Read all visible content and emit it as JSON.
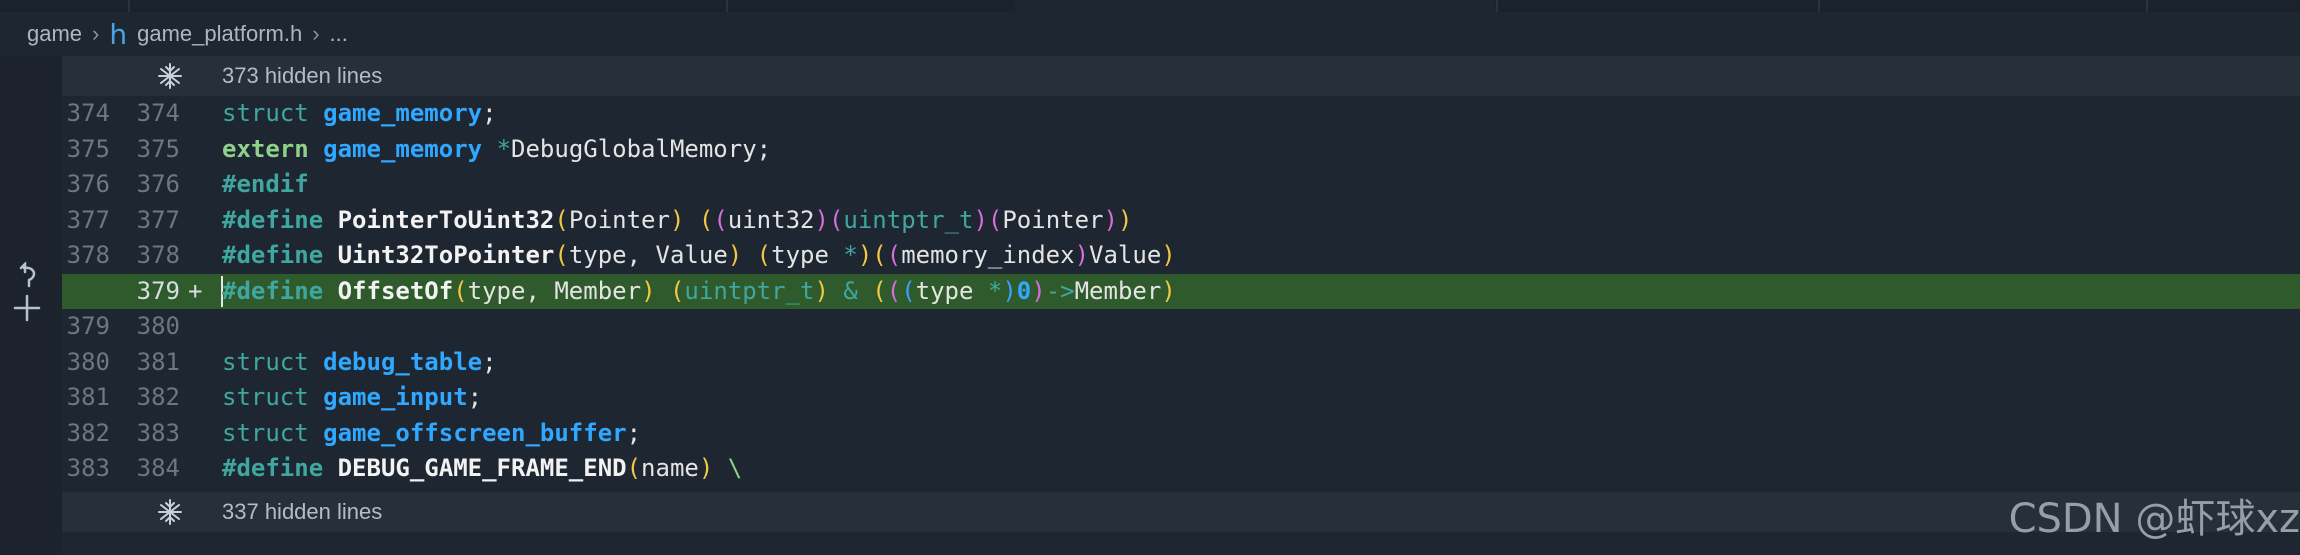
{
  "breadcrumb": {
    "root": "game",
    "file": "game_platform.h",
    "ellipsis": "..."
  },
  "hidden_top": {
    "label": "373 hidden lines"
  },
  "hidden_bottom": {
    "label": "337 hidden lines"
  },
  "lines": [
    {
      "left": "374",
      "right": "374",
      "added": false,
      "tokens": [
        [
          "kw",
          "struct"
        ],
        [
          "punc",
          " "
        ],
        [
          "type",
          "game_memory"
        ],
        [
          "punc",
          ";"
        ]
      ]
    },
    {
      "left": "375",
      "right": "375",
      "added": false,
      "tokens": [
        [
          "ext",
          "extern"
        ],
        [
          "punc",
          " "
        ],
        [
          "type",
          "game_memory"
        ],
        [
          "punc",
          " "
        ],
        [
          "op",
          "*"
        ],
        [
          "id",
          "DebugGlobalMemory"
        ],
        [
          "punc",
          ";"
        ]
      ]
    },
    {
      "left": "376",
      "right": "376",
      "added": false,
      "tokens": [
        [
          "pre",
          "#endif"
        ]
      ]
    },
    {
      "left": "377",
      "right": "377",
      "added": false,
      "tokens": [
        [
          "pre",
          "#define"
        ],
        [
          "punc",
          " "
        ],
        [
          "macro",
          "PointerToUint32"
        ],
        [
          "p1",
          "("
        ],
        [
          "id",
          "Pointer"
        ],
        [
          "p1",
          ")"
        ],
        [
          "punc",
          " "
        ],
        [
          "p1",
          "("
        ],
        [
          "p2",
          "("
        ],
        [
          "id",
          "uint32"
        ],
        [
          "p2",
          ")"
        ],
        [
          "p2",
          "("
        ],
        [
          "teal",
          "uintptr_t"
        ],
        [
          "p2",
          ")"
        ],
        [
          "p2",
          "("
        ],
        [
          "id",
          "Pointer"
        ],
        [
          "p2",
          ")"
        ],
        [
          "p1",
          ")"
        ]
      ]
    },
    {
      "left": "378",
      "right": "378",
      "added": false,
      "tokens": [
        [
          "pre",
          "#define"
        ],
        [
          "punc",
          " "
        ],
        [
          "macro",
          "Uint32ToPointer"
        ],
        [
          "p1",
          "("
        ],
        [
          "id",
          "type"
        ],
        [
          "punc",
          ", "
        ],
        [
          "id",
          "Value"
        ],
        [
          "p1",
          ")"
        ],
        [
          "punc",
          " "
        ],
        [
          "p1",
          "("
        ],
        [
          "id",
          "type"
        ],
        [
          "punc",
          " "
        ],
        [
          "op",
          "*"
        ],
        [
          "p1",
          ")"
        ],
        [
          "p1",
          "("
        ],
        [
          "p2",
          "("
        ],
        [
          "id",
          "memory_index"
        ],
        [
          "p2",
          ")"
        ],
        [
          "id",
          "Value"
        ],
        [
          "p1",
          ")"
        ]
      ]
    },
    {
      "left": "",
      "right": "379",
      "added": true,
      "plus": "+",
      "tokens": [
        [
          "pre",
          "#define"
        ],
        [
          "punc",
          " "
        ],
        [
          "macro",
          "OffsetOf"
        ],
        [
          "p1",
          "("
        ],
        [
          "id",
          "type"
        ],
        [
          "punc",
          ", "
        ],
        [
          "id",
          "Member"
        ],
        [
          "p1",
          ")"
        ],
        [
          "punc",
          " "
        ],
        [
          "p1",
          "("
        ],
        [
          "teal",
          "uintptr_t"
        ],
        [
          "p1",
          ")"
        ],
        [
          "punc",
          " "
        ],
        [
          "op",
          "&"
        ],
        [
          "punc",
          " "
        ],
        [
          "p1",
          "("
        ],
        [
          "p2",
          "("
        ],
        [
          "p3",
          "("
        ],
        [
          "id",
          "type"
        ],
        [
          "punc",
          " "
        ],
        [
          "op",
          "*"
        ],
        [
          "p3",
          ")"
        ],
        [
          "num",
          "0"
        ],
        [
          "p2",
          ")"
        ],
        [
          "op",
          "->"
        ],
        [
          "id",
          "Member"
        ],
        [
          "p1",
          ")"
        ]
      ]
    },
    {
      "left": "379",
      "right": "380",
      "added": false,
      "tokens": []
    },
    {
      "left": "380",
      "right": "381",
      "added": false,
      "tokens": [
        [
          "kw",
          "struct"
        ],
        [
          "punc",
          " "
        ],
        [
          "type",
          "debug_table"
        ],
        [
          "punc",
          ";"
        ]
      ]
    },
    {
      "left": "381",
      "right": "382",
      "added": false,
      "tokens": [
        [
          "kw",
          "struct"
        ],
        [
          "punc",
          " "
        ],
        [
          "type",
          "game_input"
        ],
        [
          "punc",
          ";"
        ]
      ]
    },
    {
      "left": "382",
      "right": "383",
      "added": false,
      "tokens": [
        [
          "kw",
          "struct"
        ],
        [
          "punc",
          " "
        ],
        [
          "type",
          "game_offscreen_buffer"
        ],
        [
          "punc",
          ";"
        ]
      ]
    },
    {
      "left": "383",
      "right": "384",
      "added": false,
      "tokens": [
        [
          "pre",
          "#define"
        ],
        [
          "punc",
          " "
        ],
        [
          "macro",
          "DEBUG_GAME_FRAME_END"
        ],
        [
          "p1",
          "("
        ],
        [
          "id",
          "name"
        ],
        [
          "p1",
          ")"
        ],
        [
          "punc",
          " "
        ],
        [
          "bs",
          "\\"
        ]
      ]
    }
  ],
  "icons": {
    "breadcrumb_separator": "chevron-right-icon",
    "file_type": "h-file-icon",
    "fold": "unfold-icon",
    "revert": "revert-arrow-icon",
    "add": "plus-icon"
  },
  "watermark": "CSDN @虾球xz",
  "colors": {
    "background": "#1e2631",
    "added_line": "#2f5a2c",
    "keyword": "#3fa7a0",
    "type": "#30a8ff",
    "bracket_level1": "#f2c744",
    "bracket_level2": "#d46ed8"
  }
}
